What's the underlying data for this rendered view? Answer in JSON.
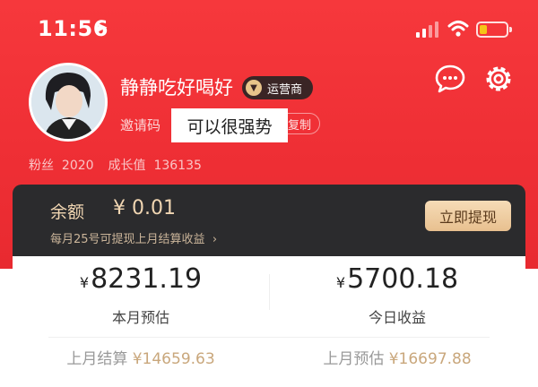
{
  "status_bar": {
    "time": "11:56"
  },
  "profile": {
    "nickname": "静静吃好喝好",
    "badge": "运营商",
    "invite_label": "邀请码",
    "invite_overlay": "可以很强势",
    "copy_label": "复制",
    "fans_label": "粉丝",
    "fans_value": "2020",
    "growth_label": "成长值",
    "growth_value": "136135"
  },
  "balance": {
    "label": "余额",
    "value": "¥ 0.01",
    "note": "每月25号可提现上月结算收益",
    "withdraw_label": "立即提现"
  },
  "stats": {
    "month_estimate": {
      "currency": "¥",
      "value": "8231.19",
      "label": "本月预估"
    },
    "today_income": {
      "currency": "¥",
      "value": "5700.18",
      "label": "今日收益"
    },
    "last_month_settled": {
      "label": "上月结算",
      "value": "¥14659.63"
    },
    "last_month_estimate": {
      "label": "上月预估",
      "value": "¥16697.88"
    }
  },
  "colors": {
    "header_red": "#f6383c",
    "card_dark": "#2b2b2d",
    "gold": "#f1d6b2",
    "muted_gold": "#c9a77c"
  },
  "icons": [
    "location-arrow-icon",
    "signal-icon",
    "wifi-icon",
    "battery-icon",
    "message-icon",
    "gear-icon",
    "badge-mark-icon",
    "chevron-right-icon"
  ]
}
